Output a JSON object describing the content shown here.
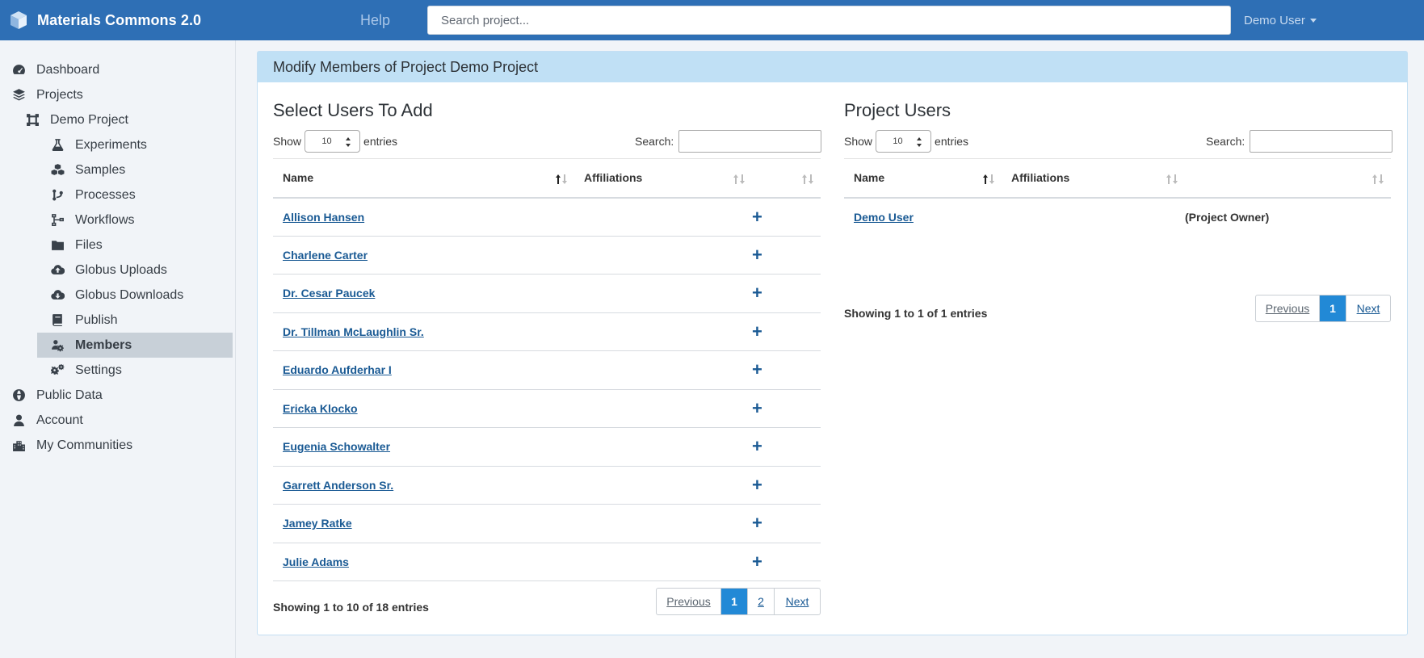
{
  "navbar": {
    "brand": "Materials Commons 2.0",
    "help": "Help",
    "search_placeholder": "Search project...",
    "user": "Demo User"
  },
  "sidebar": {
    "items": [
      {
        "label": "Dashboard",
        "icon": "dashboard-icon"
      },
      {
        "label": "Projects",
        "icon": "layers-icon"
      },
      {
        "label": "Demo Project",
        "icon": "project-icon"
      },
      {
        "label": "Experiments",
        "icon": "flask-icon"
      },
      {
        "label": "Samples",
        "icon": "cubes-icon"
      },
      {
        "label": "Processes",
        "icon": "code-branch-icon"
      },
      {
        "label": "Workflows",
        "icon": "workflow-icon"
      },
      {
        "label": "Files",
        "icon": "folder-icon"
      },
      {
        "label": "Globus Uploads",
        "icon": "cloud-upload-icon"
      },
      {
        "label": "Globus Downloads",
        "icon": "cloud-download-icon"
      },
      {
        "label": "Publish",
        "icon": "book-icon"
      },
      {
        "label": "Members",
        "icon": "users-cog-icon"
      },
      {
        "label": "Settings",
        "icon": "cogs-icon"
      },
      {
        "label": "Public Data",
        "icon": "globe-icon"
      },
      {
        "label": "Account",
        "icon": "user-icon"
      },
      {
        "label": "My Communities",
        "icon": "city-icon"
      }
    ]
  },
  "card": {
    "title": "Modify Members of Project Demo Project"
  },
  "add_panel": {
    "title": "Select Users To Add",
    "show": "Show",
    "entries_value": "10",
    "entries": "entries",
    "search_label": "Search:",
    "columns": [
      "Name",
      "Affiliations"
    ],
    "rows": [
      {
        "name": "Allison Hansen",
        "action": "+"
      },
      {
        "name": "Charlene Carter",
        "action": "+"
      },
      {
        "name": "Dr. Cesar Paucek",
        "action": "+"
      },
      {
        "name": "Dr. Tillman McLaughlin Sr.",
        "action": "+"
      },
      {
        "name": "Eduardo Aufderhar I",
        "action": "+"
      },
      {
        "name": "Ericka Klocko",
        "action": "+"
      },
      {
        "name": "Eugenia Schowalter",
        "action": "+"
      },
      {
        "name": "Garrett Anderson Sr.",
        "action": "+"
      },
      {
        "name": "Jamey Ratke",
        "action": "+"
      },
      {
        "name": "Julie Adams",
        "action": "+"
      }
    ],
    "info": "Showing 1 to 10 of 18 entries",
    "pager": {
      "previous": "Previous",
      "pages": [
        "1",
        "2"
      ],
      "next": "Next"
    }
  },
  "users_panel": {
    "title": "Project Users",
    "show": "Show",
    "entries_value": "10",
    "entries": "entries",
    "search_label": "Search:",
    "columns": [
      "Name",
      "Affiliations"
    ],
    "rows": [
      {
        "name": "Demo User",
        "role": "(Project Owner)"
      }
    ],
    "info": "Showing 1 to 1 of 1 entries",
    "pager": {
      "previous": "Previous",
      "pages": [
        "1"
      ],
      "next": "Next"
    }
  }
}
